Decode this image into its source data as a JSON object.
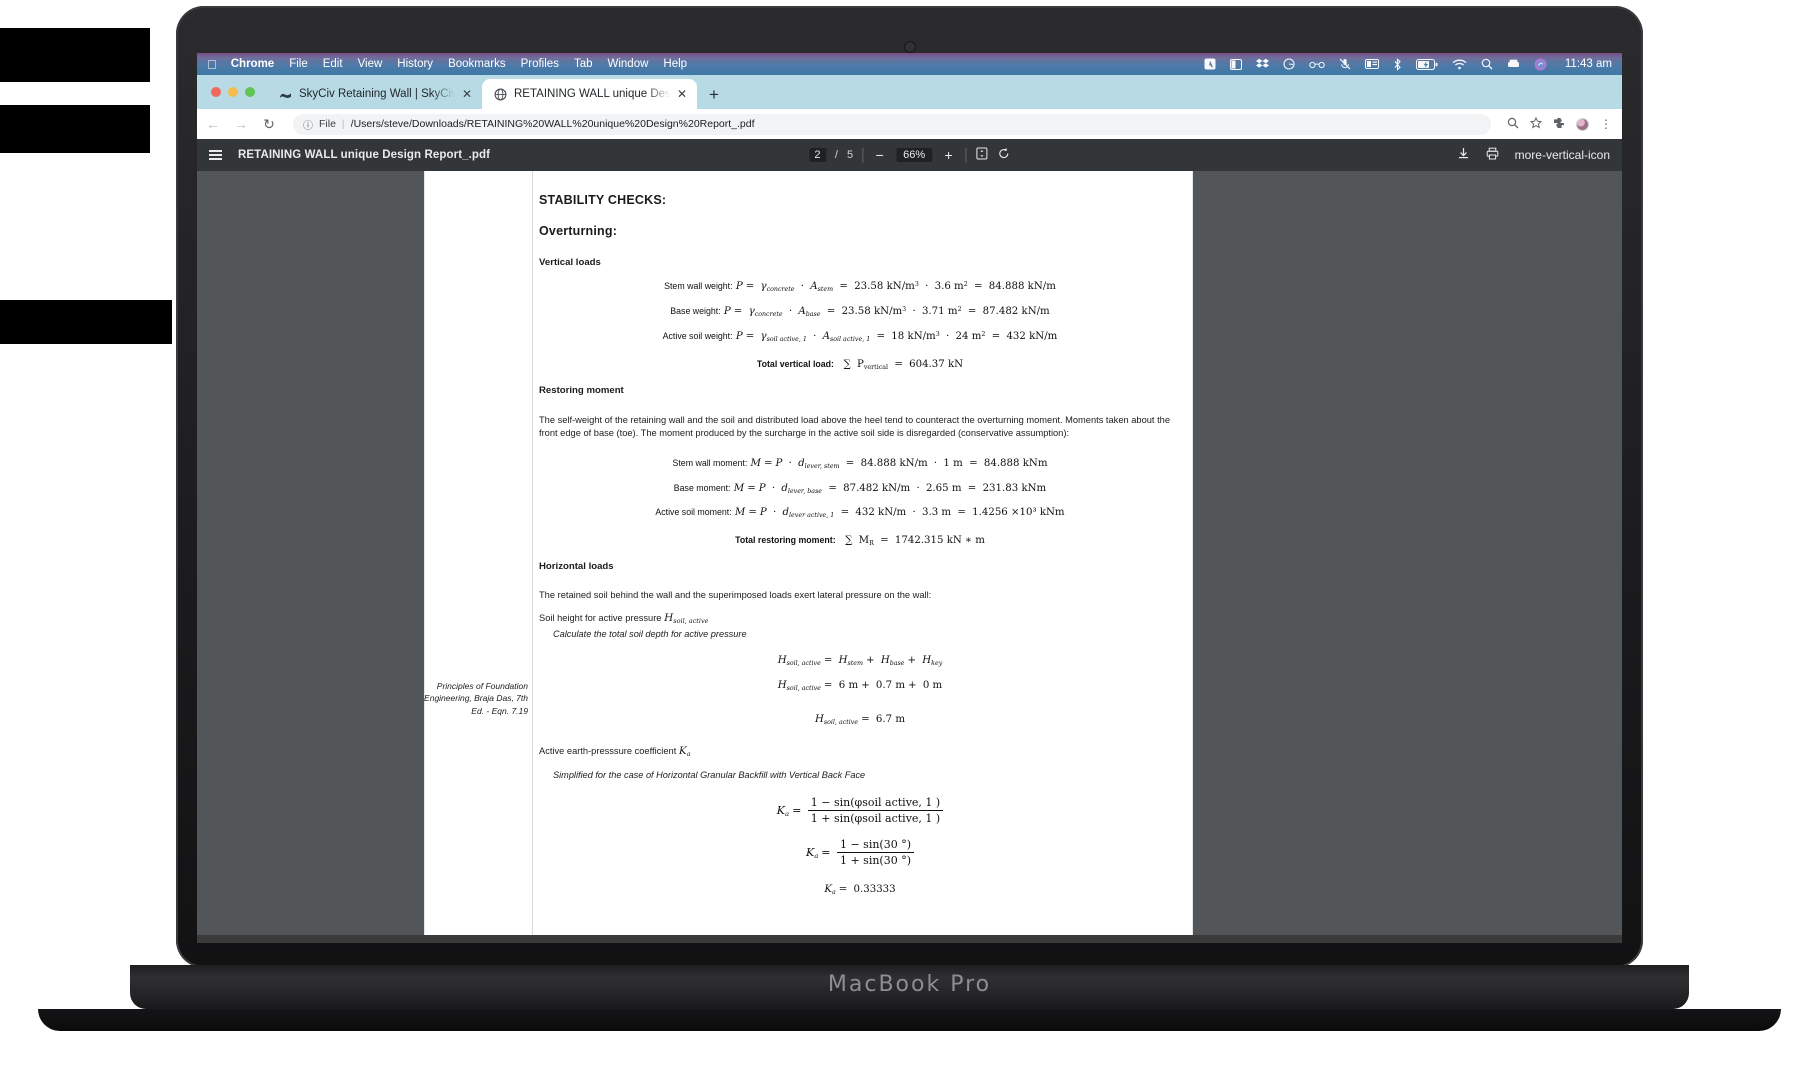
{
  "menubar": {
    "apple_icon": "apple-logo",
    "items": [
      {
        "label": "Chrome",
        "bold": true
      },
      {
        "label": "File",
        "bold": false
      },
      {
        "label": "Edit",
        "bold": false
      },
      {
        "label": "View",
        "bold": false
      },
      {
        "label": "History",
        "bold": false
      },
      {
        "label": "Bookmarks",
        "bold": false
      },
      {
        "label": "Profiles",
        "bold": false
      },
      {
        "label": "Tab",
        "bold": false
      },
      {
        "label": "Window",
        "bold": false
      },
      {
        "label": "Help",
        "bold": false
      }
    ],
    "status_icons": [
      "adobe-creative-cloud-icon",
      "split-view-icon",
      "dropbox-icon",
      "grammarly-icon",
      "eyeglasses-icon",
      "microphone-mute-icon",
      "screen-capture-icon",
      "bluetooth-icon",
      "battery-charging-icon",
      "wifi-icon",
      "spotlight-search-icon",
      "time-machine-icon",
      "siri-icon"
    ],
    "clock": "11:43 am"
  },
  "browser": {
    "tabs": [
      {
        "title": "SkyCiv Retaining Wall | SkyCiv",
        "favicon": "skyciv-favicon",
        "active": false,
        "close_label": "✕"
      },
      {
        "title": "RETAINING WALL unique Desig",
        "favicon": "pdf-globe-favicon",
        "active": true,
        "close_label": "✕"
      }
    ],
    "new_tab_label": "+",
    "nav": {
      "back": "←",
      "forward": "→",
      "reload": "↻"
    },
    "omnibox": {
      "info_icon": "info-circle-icon",
      "scheme": "File",
      "separator": "|",
      "url": "/Users/steve/Downloads/RETAINING%20WALL%20unique%20Design%20Report_.pdf"
    },
    "toolbar_icons": [
      "zoom-icon",
      "bookmark-star-icon",
      "extensions-puzzle-icon",
      "profile-avatar",
      "chrome-menu-icon"
    ]
  },
  "pdf_viewer": {
    "menu_icon": "hamburger-menu-icon",
    "document_title": "RETAINING WALL unique Design Report_.pdf",
    "page_current": "2",
    "page_separator": "/",
    "page_total": "5",
    "zoom_out_label": "−",
    "zoom_value": "66%",
    "zoom_in_label": "+",
    "fit_icon": "fit-page-icon",
    "rotate_icon": "rotate-icon",
    "download_icon": "download-icon",
    "print_icon": "print-icon",
    "more_icon": "more-vertical-icon"
  },
  "document": {
    "title": "STABILITY CHECKS:",
    "section": "Overturning:",
    "vertical_loads": {
      "heading": "Vertical loads",
      "equations": [
        {
          "label": "Stem wall weight:",
          "lhs": "P",
          "expr": "= γconcrete · Astem = 23.58 kN/m³ · 3.6 m² = 84.888 kN/m",
          "var_sym": "P",
          "gamma_sub": "concrete",
          "area_sub": "stem",
          "gamma_val": "23.58",
          "gamma_unit": "kN/m",
          "area_val": "3.6",
          "area_unit": "m",
          "result": "84.888 kN/m"
        },
        {
          "label": "Base weight:",
          "var_sym": "P",
          "gamma_sub": "concrete",
          "area_sub": "base",
          "gamma_val": "23.58",
          "gamma_unit": "kN/m",
          "area_val": "3.71",
          "area_unit": "m",
          "result": "87.482 kN/m"
        },
        {
          "label": "Active soil weight:",
          "var_sym": "P",
          "gamma_sub": "soil active, 1",
          "area_sub": "soil active, 1",
          "gamma_val": "18",
          "gamma_unit": "kN/m",
          "area_val": "24",
          "area_unit": "m",
          "result": "432 kN/m"
        }
      ],
      "total_label": "Total vertical load:",
      "total_sym": "P",
      "total_sub": "vertical",
      "total_value": "604.37 kN"
    },
    "restoring_moment": {
      "heading": "Restoring moment",
      "paragraph": "The self-weight of the retaining wall and the soil and distributed load above the heel tend to counteract the overturning moment. Moments taken about the front edge of base (toe). The moment produced by the surcharge in the active soil side is disregarded (conservative assumption):",
      "equations": [
        {
          "label": "Stem wall moment:",
          "lhs": "M",
          "d_sub": "lever, stem",
          "p_val": "84.888 kN/m",
          "d_val": "1 m",
          "result": "84.888 kNm"
        },
        {
          "label": "Base moment:",
          "lhs": "M",
          "d_sub": "lever, base",
          "p_val": "87.482 kN/m",
          "d_val": "2.65 m",
          "result": "231.83 kNm"
        },
        {
          "label": "Active soil moment:",
          "lhs": "M",
          "d_sub": "lever active, 1",
          "p_val": "432 kN/m",
          "d_val": "3.3 m",
          "result": "1.4256 ×10³ kNm"
        }
      ],
      "total_label": "Total restoring moment:",
      "total_sym": "M",
      "total_sub": "R",
      "total_value": "1742.315 kN ∗ m"
    },
    "horizontal_loads": {
      "heading": "Horizontal loads",
      "paragraph": "The retained soil behind the wall and the superimposed loads exert lateral pressure on the wall:",
      "soil_height_label": "Soil height for active pressure",
      "soil_height_sym": "H",
      "soil_height_sub": "soil, active",
      "calc_note": "Calculate the total soil depth for active pressure",
      "eq_symbolic": "Hsoil, active = Hstem + Hbase + Hkey",
      "eq_numeric_terms": [
        "6 m",
        "0.7 m",
        "0 m"
      ],
      "eq_result": "6.7 m",
      "ka_label": "Active earth-presssure coefficient",
      "ka_sym": "K",
      "ka_sub": "a",
      "ka_note": "Simplified for the case of Horizontal Granular Backfill with Vertical Back Face",
      "ka_num_sym": "1 − sin(φsoil active, 1 )",
      "ka_den_sym": "1 + sin(φsoil active, 1 )",
      "ka_num_val": "1 − sin(30 °)",
      "ka_den_val": "1 + sin(30 °)",
      "ka_result": "0.33333",
      "sidenote": "Principles of Foundation Engineering, Braja Das, 7th Ed. - Eqn. 7.19"
    }
  },
  "laptop": {
    "brand": "MacBook Pro"
  },
  "colors": {
    "menubar_accent": "#4f7aa8",
    "tabstrip": "#b7dae4",
    "pdf_chrome": "#323639",
    "pdf_backdrop": "#535659"
  }
}
